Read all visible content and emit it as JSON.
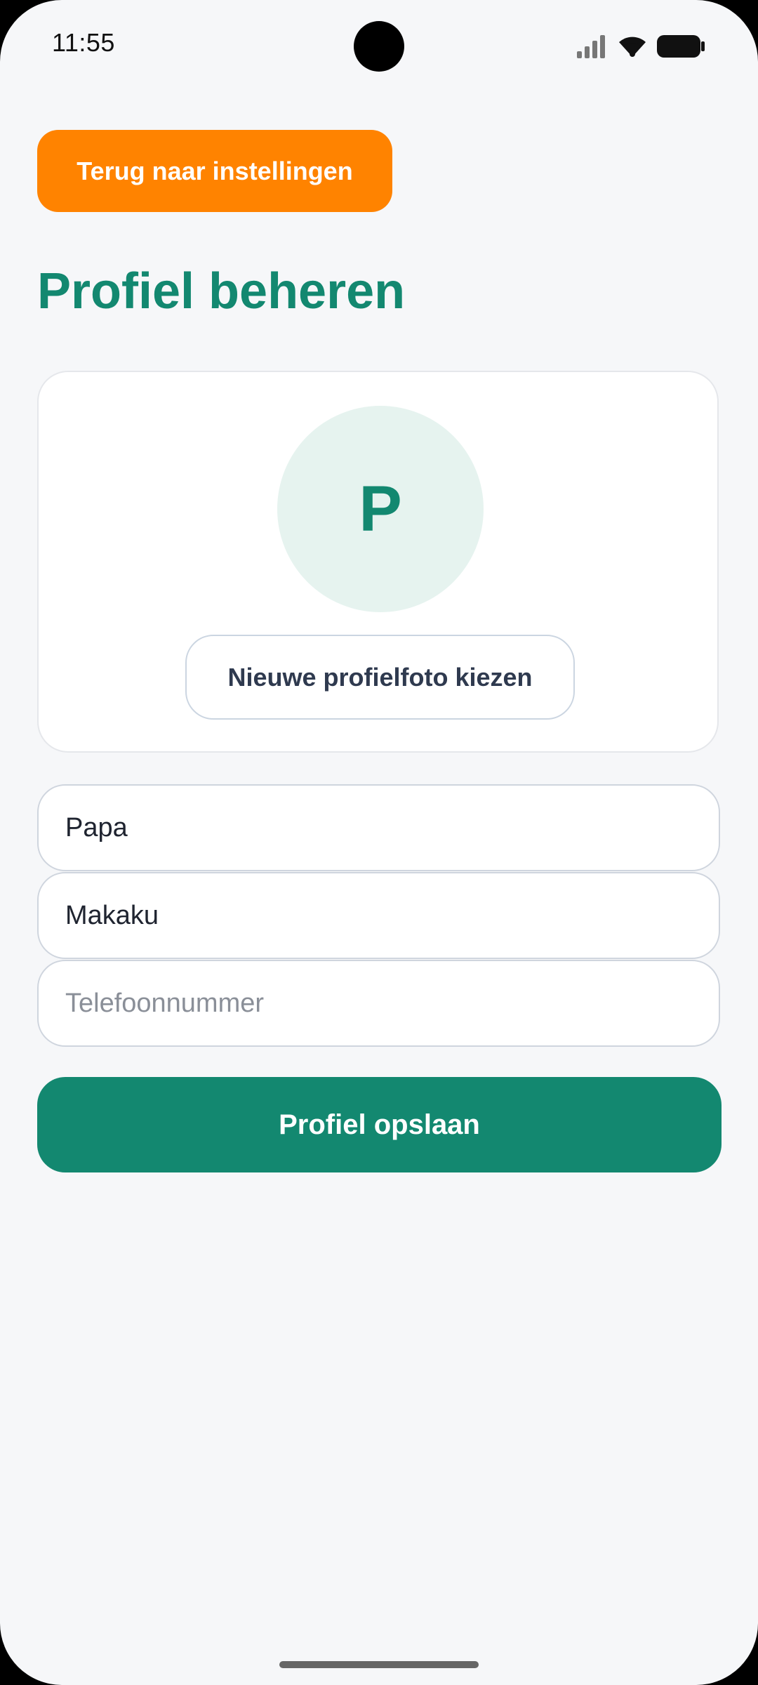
{
  "status_bar": {
    "time": "11:55",
    "icons": [
      "signal-icon",
      "wifi-icon",
      "battery-icon"
    ]
  },
  "back_button": {
    "label": "Terug naar instellingen"
  },
  "page": {
    "title": "Profiel beheren"
  },
  "avatar_card": {
    "initial": "P",
    "choose_photo_label": "Nieuwe profielfoto kiezen"
  },
  "form": {
    "first_name": {
      "value": "Papa",
      "placeholder": ""
    },
    "last_name": {
      "value": "Makaku",
      "placeholder": ""
    },
    "phone": {
      "value": "",
      "placeholder": "Telefoonnummer"
    }
  },
  "save_button": {
    "label": "Profiel opslaan"
  },
  "colors": {
    "accent_orange": "#FF8300",
    "brand_green": "#138870",
    "avatar_bg": "#E6F3EF",
    "page_bg": "#F6F7F9"
  }
}
